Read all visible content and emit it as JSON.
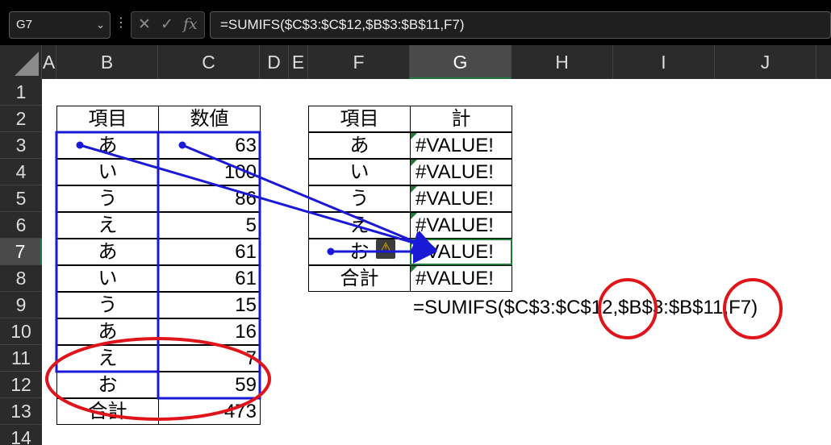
{
  "name_box": "G7",
  "formula_bar": {
    "cancel_icon": "✕",
    "enter_icon": "✓",
    "fx_label": "fx",
    "formula": "=SUMIFS($C$3:$C$12,$B$3:$B$11,F7)"
  },
  "columns": [
    "A",
    "B",
    "C",
    "D",
    "E",
    "F",
    "G",
    "H",
    "I",
    "J"
  ],
  "rows": [
    "1",
    "2",
    "3",
    "4",
    "5",
    "6",
    "7",
    "8",
    "9",
    "10",
    "11",
    "12",
    "13",
    "14"
  ],
  "left_table": {
    "header_item": "項目",
    "header_value": "数値",
    "items": [
      "あ",
      "い",
      "う",
      "え",
      "あ",
      "い",
      "う",
      "あ",
      "え",
      "お",
      "合計"
    ],
    "values": [
      "63",
      "100",
      "86",
      "5",
      "61",
      "61",
      "15",
      "16",
      "7",
      "59",
      "473"
    ]
  },
  "right_table": {
    "header_item": "項目",
    "header_total": "計",
    "items": [
      "あ",
      "い",
      "う",
      "え",
      "お",
      "合計"
    ],
    "results": [
      "#VALUE!",
      "#VALUE!",
      "#VALUE!",
      "#VALUE!",
      "#VALUE!",
      "#VALUE!"
    ]
  },
  "formula_display": "=SUMIFS($C$3:$C$12,$B$3:$B$11,F7)",
  "colors": {
    "precedent_trace": "#1a1ad6",
    "highlight_circle": "#e0151b",
    "active_header": "#1e7b34"
  }
}
